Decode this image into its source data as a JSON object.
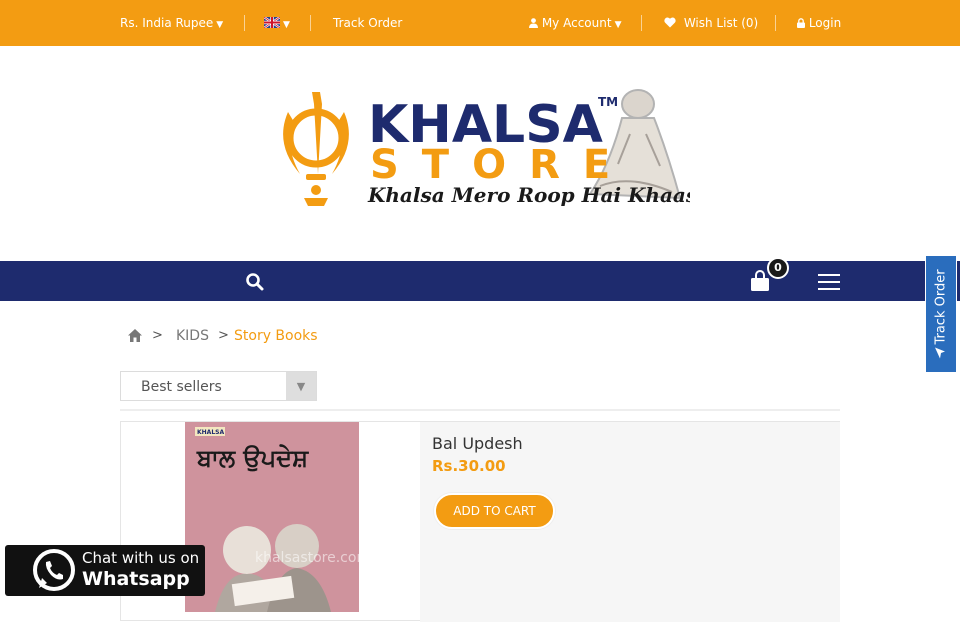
{
  "topbar": {
    "currency_label": "Rs. India Rupee",
    "language_flag": "uk-flag-icon",
    "track_order": "Track Order",
    "my_account": "My Account",
    "wishlist": "Wish List (0)",
    "login": "Login"
  },
  "logo": {
    "line1": "KHALSA",
    "tm": "TM",
    "line2": "STORE",
    "tagline": "Khalsa Mero Roop Hai Khaas"
  },
  "navbar": {
    "cart_count": "0"
  },
  "breadcrumb": {
    "items": [
      "KIDS",
      "Story Books"
    ],
    "separator": ">"
  },
  "sort": {
    "selected": "Best sellers"
  },
  "product": {
    "title": "Bal Updesh",
    "price": "Rs.30.00",
    "add_to_cart": "ADD TO CART",
    "cover_badge": "KHALSA",
    "cover_title": "ਬਾਲ ਉਪਦੇਸ਼",
    "cover_watermark": "khalsastore.com"
  },
  "side_tab": {
    "label": "Track Order"
  },
  "whatsapp": {
    "line1": "Chat with us on",
    "line2": "Whatsapp"
  },
  "colors": {
    "brand_orange": "#f39c12",
    "navbar_navy": "#1e2b6e",
    "side_tab_blue": "#2a6dbd"
  }
}
